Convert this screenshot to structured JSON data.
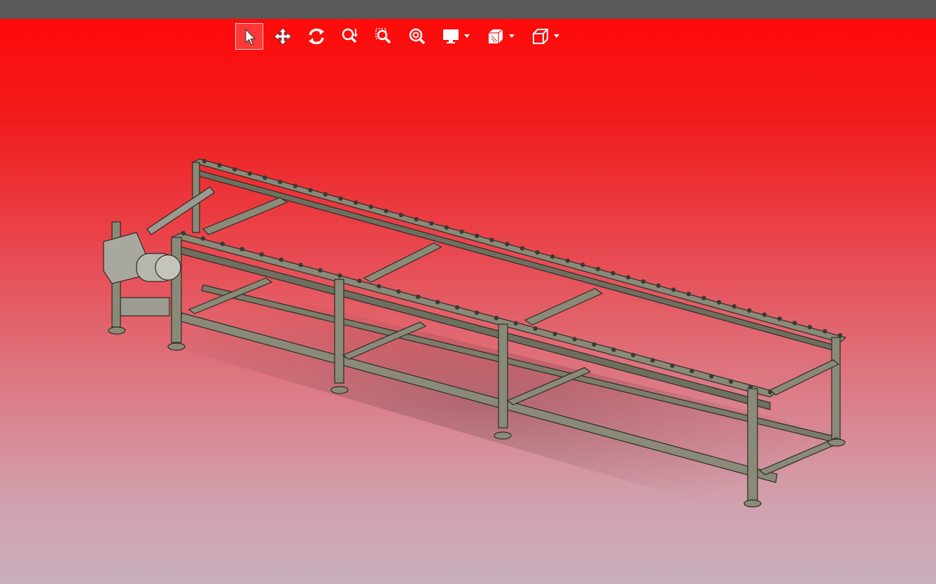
{
  "window": {
    "title_bar": ""
  },
  "toolbar": {
    "buttons": [
      {
        "name": "select-tool",
        "icon": "cursor-arrow-icon",
        "active": true
      },
      {
        "name": "pan-tool",
        "icon": "move-arrows-icon"
      },
      {
        "name": "rotate-tool",
        "icon": "rotate-icon"
      },
      {
        "name": "zoom-in-out-tool",
        "icon": "zoom-updown-icon"
      },
      {
        "name": "zoom-window-tool",
        "icon": "zoom-window-icon"
      },
      {
        "name": "zoom-fit-tool",
        "icon": "zoom-fit-icon"
      },
      {
        "name": "display-mode-menu",
        "icon": "monitor-icon",
        "dropdown": true
      },
      {
        "name": "section-view-menu",
        "icon": "section-cube-icon",
        "dropdown": true
      },
      {
        "name": "view-orientation-menu",
        "icon": "cube-icon",
        "dropdown": true
      }
    ]
  },
  "colors": {
    "title_bar": "#595959",
    "background_top": "#ff0a0a",
    "background_bottom": "#c9afbd",
    "model_metal": "#7a7a68",
    "toolbar_icon": "#ffffff"
  },
  "model": {
    "subject": "conveyor-frame-assembly"
  }
}
